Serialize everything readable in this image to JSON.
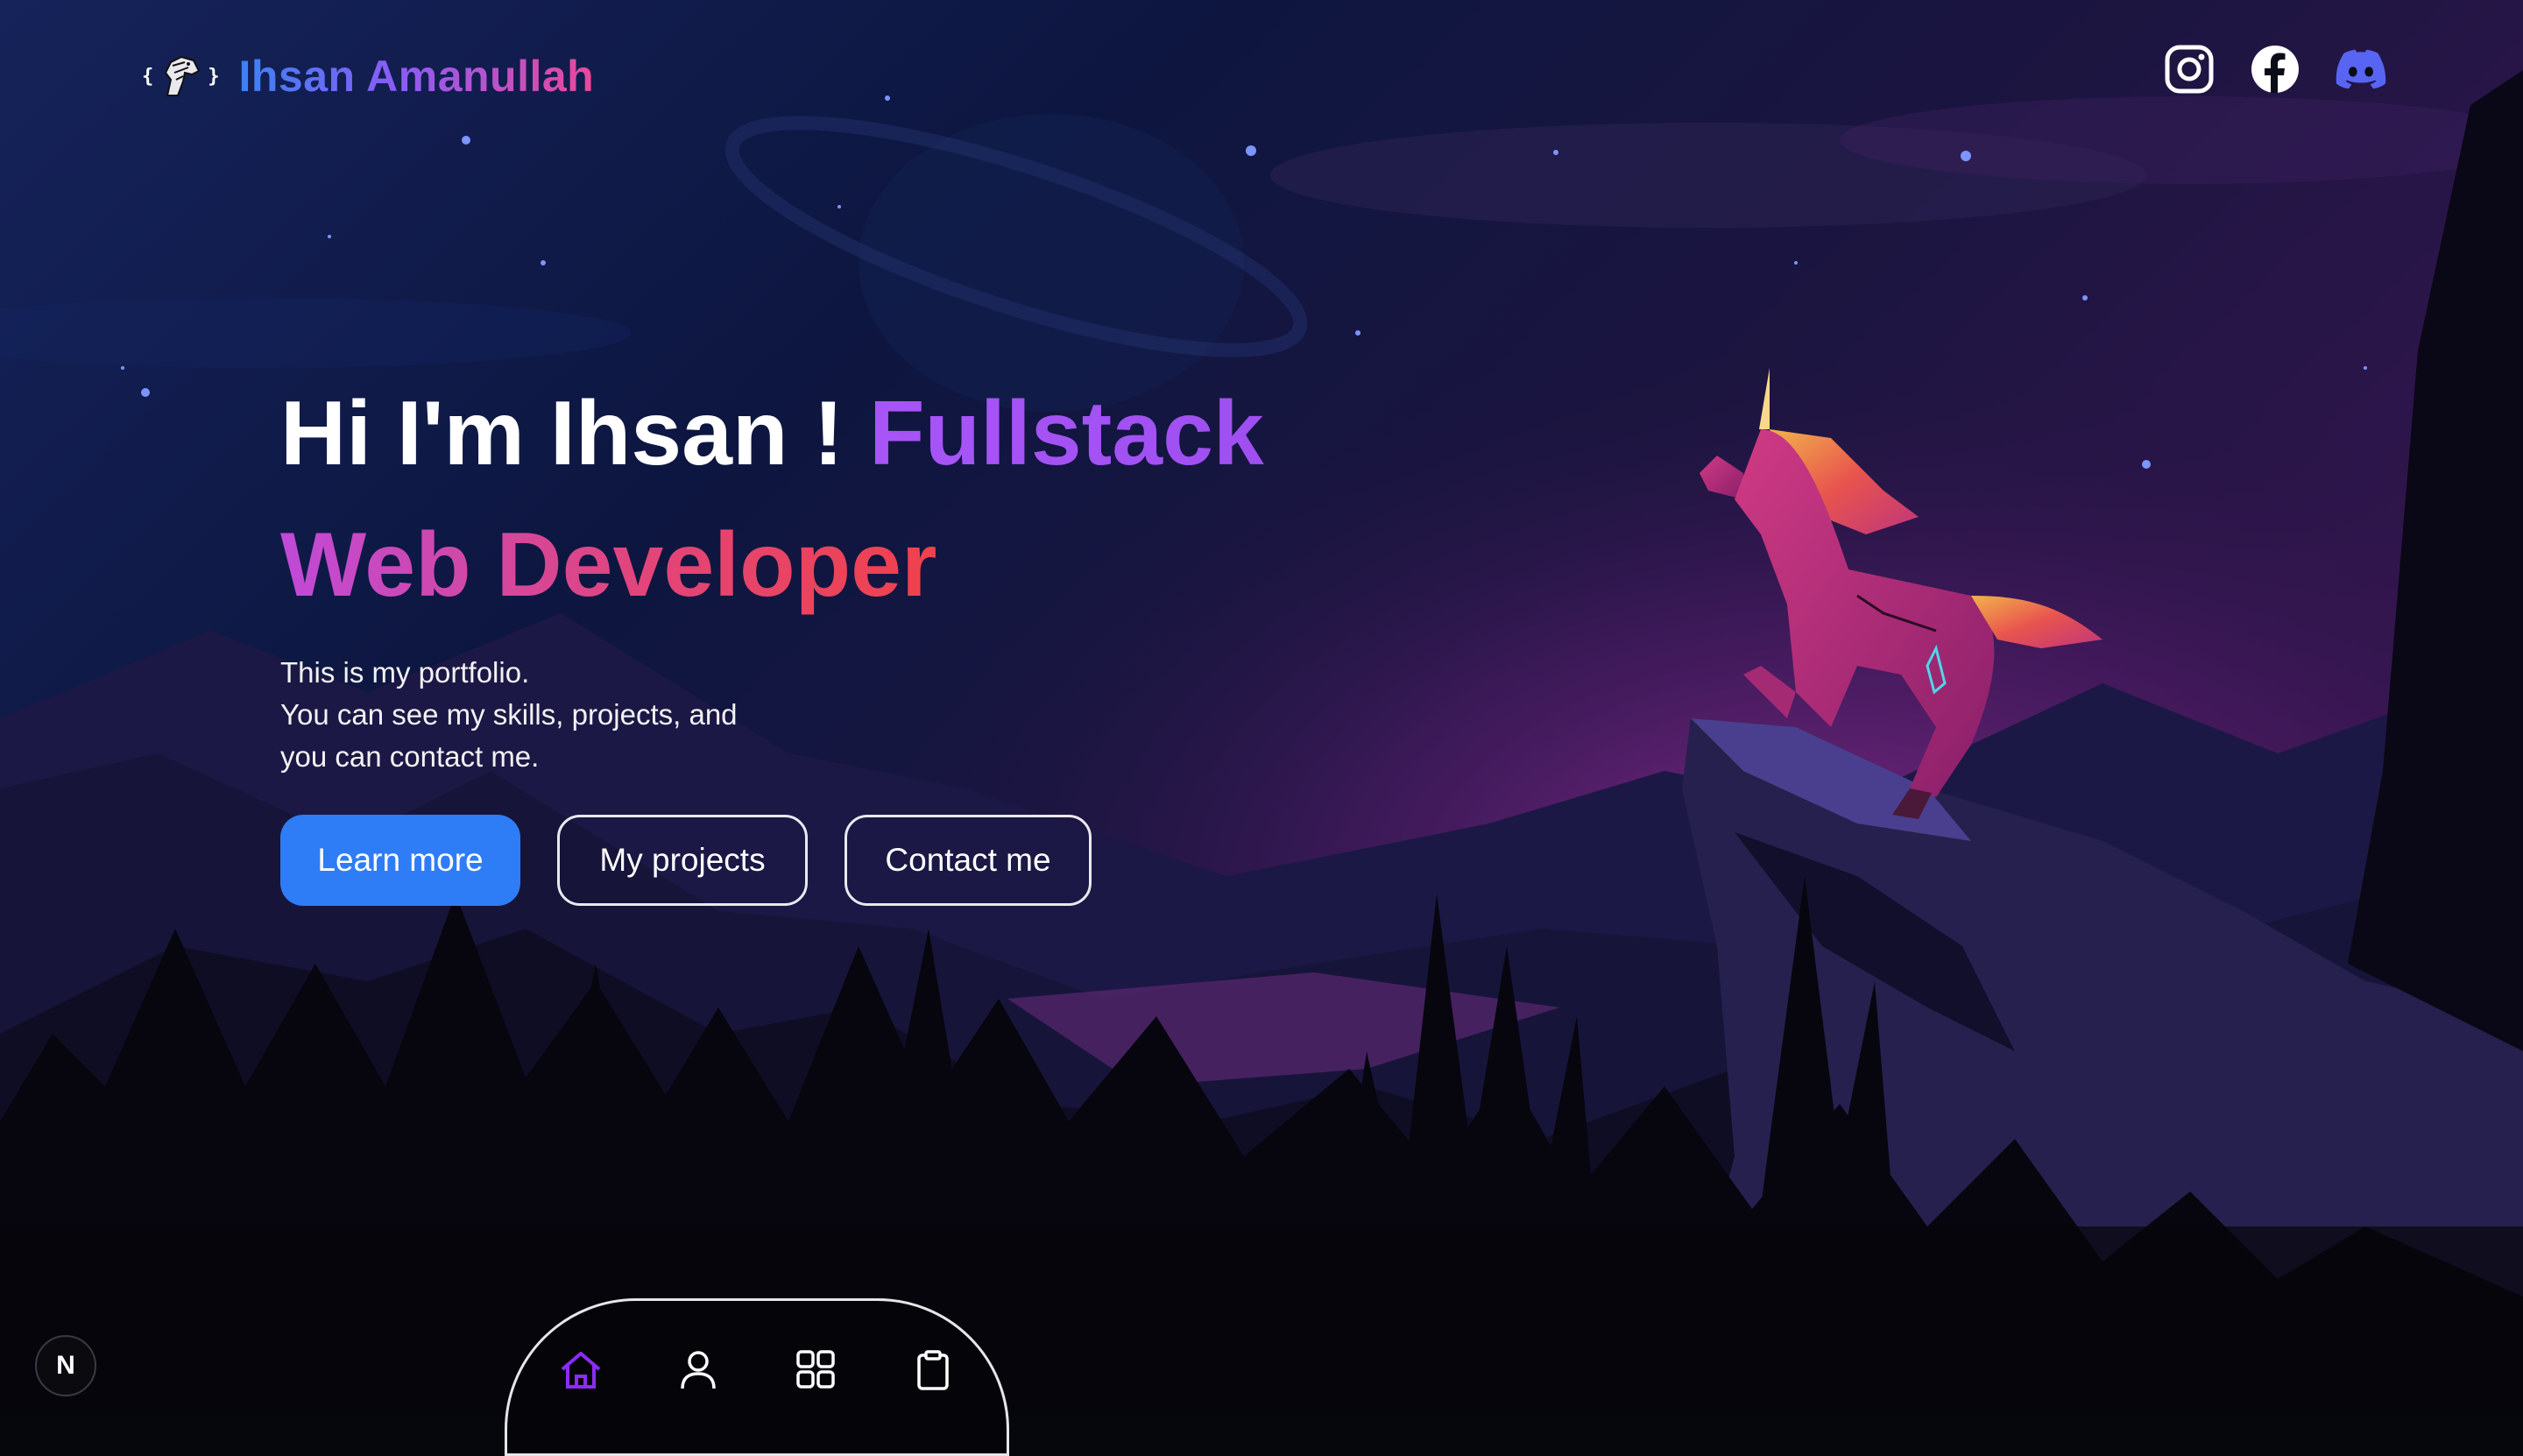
{
  "header": {
    "logo_braces_left": "{",
    "logo_braces_right": "}",
    "logo_icon": "horse-head-icon",
    "name": "Ihsan Amanullah"
  },
  "socials": [
    {
      "icon": "instagram-icon"
    },
    {
      "icon": "facebook-icon"
    },
    {
      "icon": "discord-icon"
    }
  ],
  "hero": {
    "title_part1": "Hi I'm Ihsan ! ",
    "title_part2": "Fullstack",
    "title_part3": "Web Developer",
    "desc_line1": "This is my portfolio.",
    "desc_line2": "You can see my skills, projects, and",
    "desc_line3": "you can contact me."
  },
  "buttons": {
    "learn_more": "Learn more",
    "my_projects": "My projects",
    "contact_me": "Contact me"
  },
  "bottom_nav": [
    {
      "icon": "home-icon",
      "active": true
    },
    {
      "icon": "user-icon",
      "active": false
    },
    {
      "icon": "grid-icon",
      "active": false
    },
    {
      "icon": "clipboard-icon",
      "active": false
    }
  ],
  "badge": {
    "label": "N"
  },
  "colors": {
    "accent_blue": "#2f7df6",
    "accent_purple": "#a855f7",
    "accent_pink": "#ec4899",
    "discord": "#5865f2",
    "nav_active": "#8b2cf5"
  }
}
